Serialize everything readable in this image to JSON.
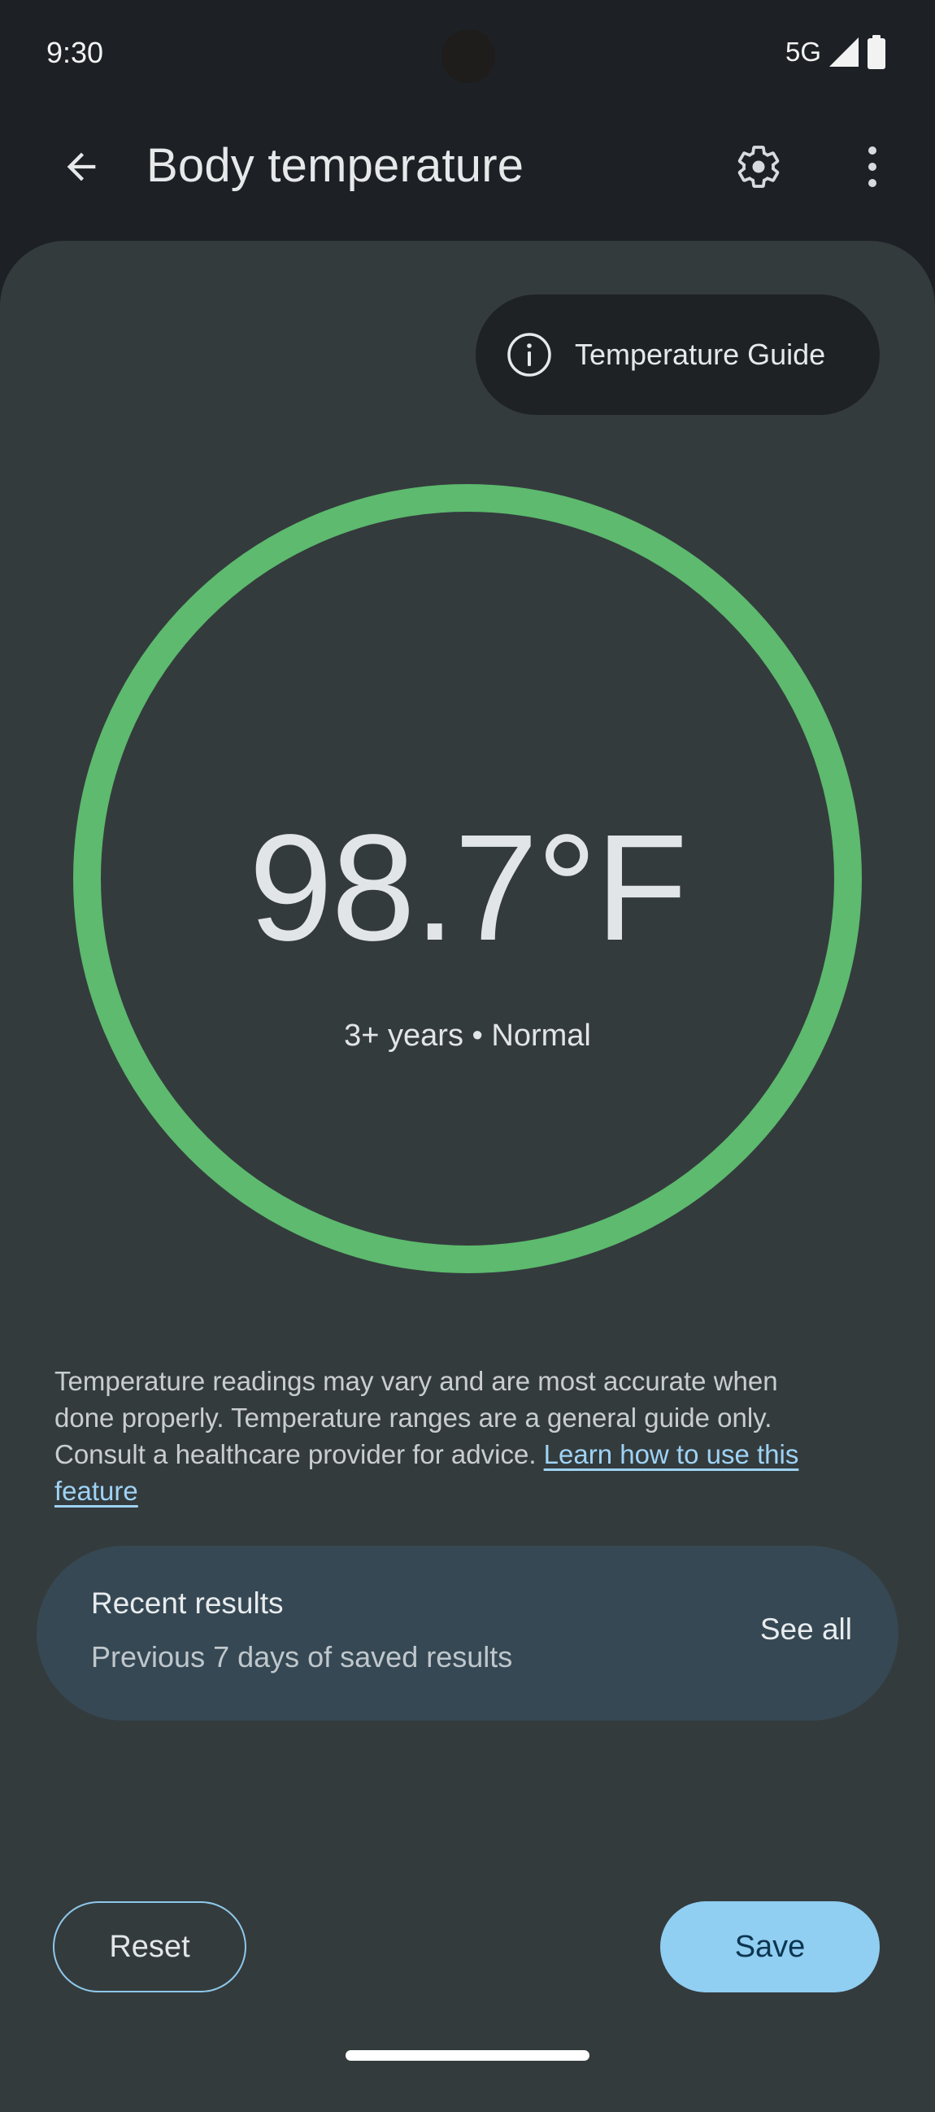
{
  "status_bar": {
    "time": "9:30",
    "network": "5G",
    "icons": [
      "signal-icon",
      "battery-icon"
    ]
  },
  "app_bar": {
    "title": "Body temperature",
    "back_icon": "arrow-back-icon",
    "settings_icon": "gear-icon",
    "more_icon": "more-vert-icon"
  },
  "guide": {
    "label": "Temperature Guide",
    "icon": "info-icon"
  },
  "reading": {
    "value": "98.7°F",
    "subtitle": "3+ years • Normal",
    "status_color": "#5dba6e"
  },
  "disclaimer": {
    "text": "Temperature readings may vary and are most accurate when done properly. Temperature ranges are a general guide only. Consult a healthcare provider for advice. ",
    "link_text": "Learn how to use this feature"
  },
  "recent_results": {
    "title": "Recent results",
    "subtitle": "Previous 7 days of saved results",
    "action": "See all"
  },
  "actions": {
    "reset": "Reset",
    "save": "Save"
  },
  "colors": {
    "accent": "#90cef2",
    "ring": "#5dba6e",
    "surface": "#343b3d",
    "background": "#1d2024"
  }
}
